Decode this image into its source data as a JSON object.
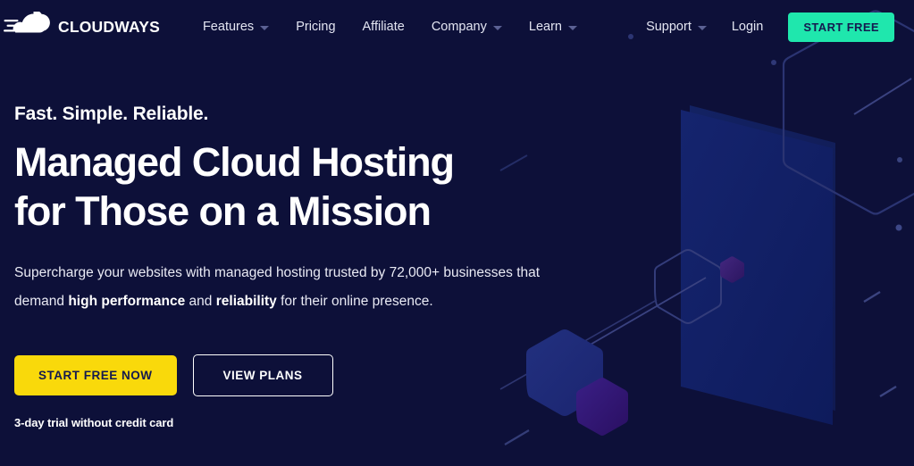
{
  "page": {
    "background_color": "#0d1039",
    "accent_mint": "#1fe7ad",
    "accent_yellow": "#f9d90b"
  },
  "header": {
    "brand": {
      "name": "CLOUDWAYS",
      "logo_icon": "cloud-speed-icon"
    },
    "nav_items": [
      {
        "label": "Features",
        "has_dropdown": true
      },
      {
        "label": "Pricing",
        "has_dropdown": false
      },
      {
        "label": "Affiliate",
        "has_dropdown": false
      },
      {
        "label": "Company",
        "has_dropdown": true
      },
      {
        "label": "Learn",
        "has_dropdown": true
      }
    ],
    "right_items": [
      {
        "label": "Support",
        "has_dropdown": true
      },
      {
        "label": "Login",
        "has_dropdown": false
      }
    ],
    "cta_label": "START FREE"
  },
  "hero": {
    "eyebrow": "Fast. Simple. Reliable.",
    "title_line_1": "Managed Cloud Hosting",
    "title_line_2": "for Those on a Mission",
    "subtitle_part_1": "Supercharge your websites with managed hosting trusted by 72,000+ businesses that demand ",
    "subtitle_bold_1": "high performance",
    "subtitle_part_2": " and ",
    "subtitle_bold_2": "reliability",
    "subtitle_part_3": " for their online presence.",
    "primary_cta": "START FREE NOW",
    "secondary_cta": "VIEW PLANS",
    "trial_note": "3-day trial without credit card"
  }
}
